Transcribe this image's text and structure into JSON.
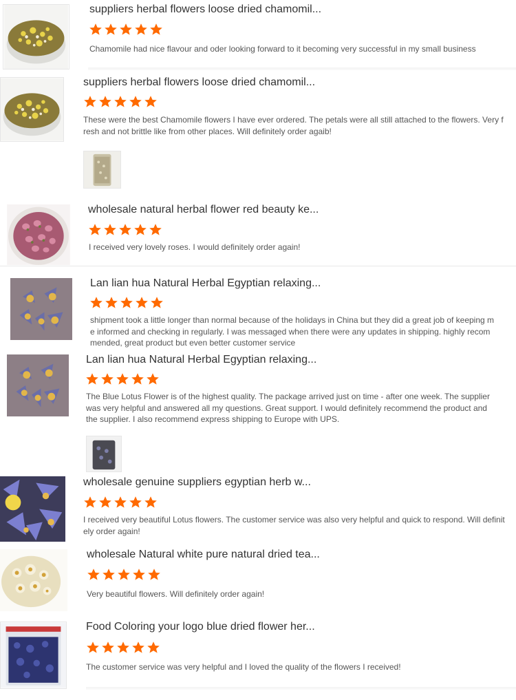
{
  "reviews": [
    {
      "title": "suppliers herbal flowers loose dried chamomil...",
      "rating": 5,
      "text": "Chamomile had nice flavour and oder looking forward to it becoming very successful in my small business",
      "image": "chamomile-bowl"
    },
    {
      "title": "suppliers herbal flowers loose dried chamomil...",
      "rating": 5,
      "text": "These were the best Chamomile flowers I have ever ordered. The petals were all still attached to the flowers. Very fresh and not brittle like from other places. Will definitely order agaib!",
      "image": "chamomile-bowl",
      "photo": "jar-photo"
    },
    {
      "title": "wholesale natural herbal flower red beauty ke...",
      "rating": 5,
      "text": "I received very lovely roses. I would definitely order again!",
      "image": "rose-buds-bowl"
    },
    {
      "title": "Lan lian hua Natural Herbal Egyptian relaxing...",
      "rating": 5,
      "text": "shipment took a little longer than normal because of the holidays in China but they did a great job of keeping me informed and checking in regularly. I was messaged when there were any updates in shipping. highly recommended, great product but even better customer service",
      "image": "blue-lotus"
    },
    {
      "title": "Lan lian hua Natural Herbal Egyptian relaxing...",
      "rating": 5,
      "text": "The Blue Lotus Flower is of the highest quality. The package arrived just on time - after one week. The supplier was very helpful and answered all my questions. Great support. I would definitely recommend the product and the supplier. I also recommend express shipping to Europe with UPS.",
      "image": "blue-lotus",
      "photo": "package-photo"
    },
    {
      "title": "wholesale genuine suppliers egyptian herb w...",
      "rating": 5,
      "text": "I received very beautiful Lotus flowers. The customer service was also very helpful and quick to respond. Will definitely order again!",
      "image": "lotus-closeup"
    },
    {
      "title": "wholesale Natural white pure natural dried tea...",
      "rating": 5,
      "text": "Very beautiful flowers. Will definitely order again!",
      "image": "white-flowers"
    },
    {
      "title": "Food Coloring your logo blue dried flower her...",
      "rating": 5,
      "text": "The customer service was very helpful and I loved the quality of the flowers I received!",
      "image": "butterfly-pea-bag"
    }
  ],
  "colors": {
    "star": "#ff6a00",
    "title": "#333333",
    "body": "#555555"
  }
}
